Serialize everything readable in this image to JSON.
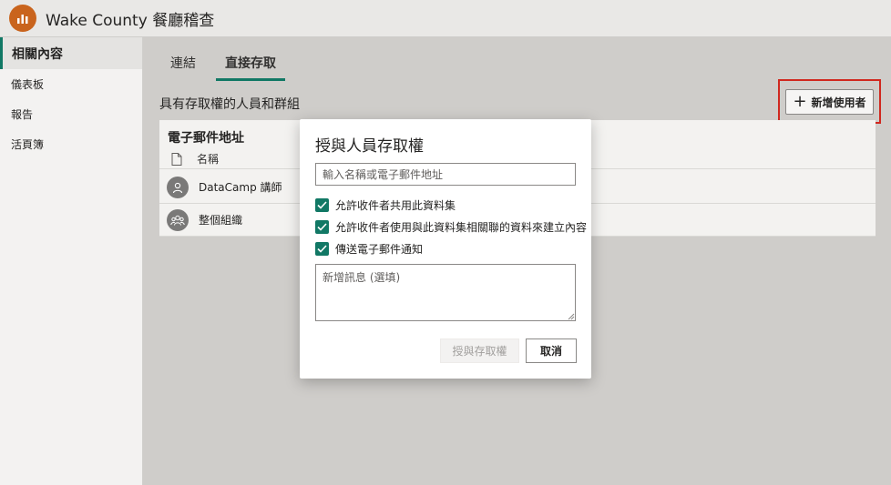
{
  "header": {
    "title": "Wake County 餐廳稽查",
    "icon": "report-chart-icon",
    "accent": "#c9641d"
  },
  "sidebar": {
    "items": [
      {
        "label": "相關內容",
        "active": true
      },
      {
        "label": "儀表板"
      },
      {
        "label": "報告"
      },
      {
        "label": "活頁簿"
      }
    ]
  },
  "tabs": [
    {
      "label": "連結"
    },
    {
      "label": "直接存取",
      "active": true
    }
  ],
  "section": {
    "title": "具有存取權的人員和群組"
  },
  "add_user": {
    "label": "新增使用者"
  },
  "table": {
    "title": "電子郵件地址",
    "column_name": "名稱",
    "rows": [
      {
        "label": "DataCamp 講師",
        "icon": "person-icon"
      },
      {
        "label": "整個組織",
        "icon": "group-icon"
      }
    ]
  },
  "dialog": {
    "title": "授與人員存取權",
    "input_placeholder": "輸入名稱或電子郵件地址",
    "options": [
      {
        "label": "允許收件者共用此資料集",
        "checked": true
      },
      {
        "label": "允許收件者使用與此資料集相關聯的資料來建立內容",
        "checked": true
      },
      {
        "label": "傳送電子郵件通知",
        "checked": true
      }
    ],
    "message_placeholder": "新增訊息 (選填)",
    "grant_label": "授與存取權",
    "cancel_label": "取消"
  },
  "colors": {
    "accent": "#117865",
    "highlight": "#d0281f"
  }
}
